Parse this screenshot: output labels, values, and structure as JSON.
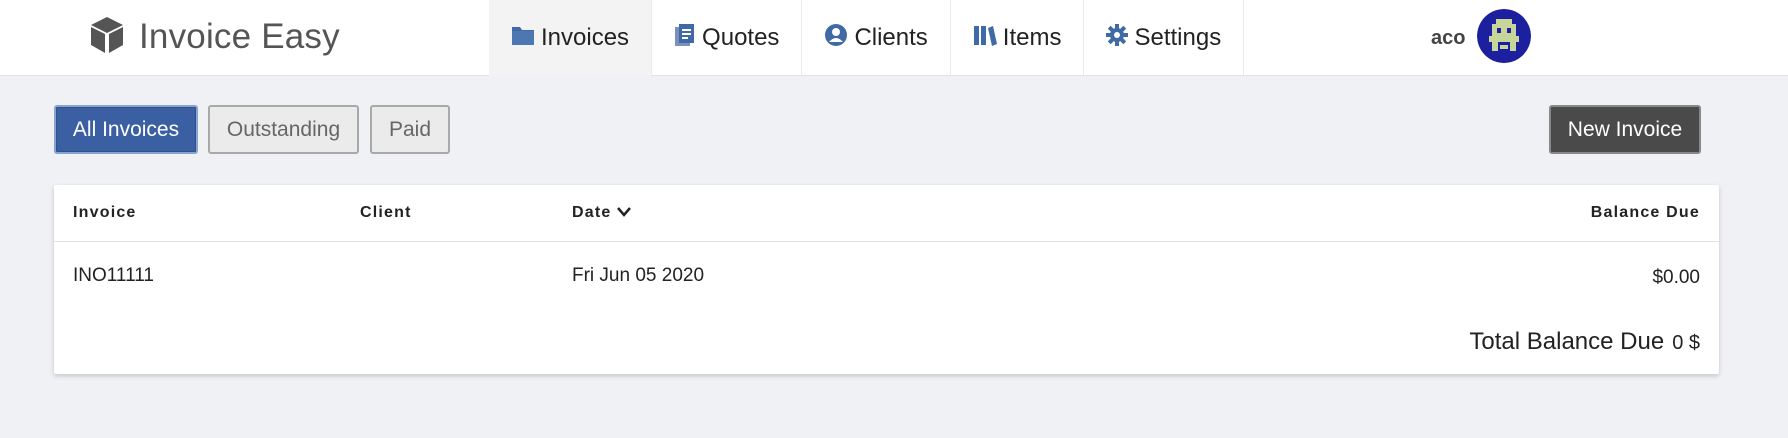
{
  "app": {
    "title": "Invoice Easy"
  },
  "nav": {
    "items": [
      {
        "label": "Invoices",
        "icon": "folder-icon",
        "active": true
      },
      {
        "label": "Quotes",
        "icon": "document-icon",
        "active": false
      },
      {
        "label": "Clients",
        "icon": "user-circle-icon",
        "active": false
      },
      {
        "label": "Items",
        "icon": "books-icon",
        "active": false
      },
      {
        "label": "Settings",
        "icon": "gear-icon",
        "active": false
      }
    ]
  },
  "user": {
    "name": "aco",
    "avatar_icon": "pixel-avatar-icon"
  },
  "filters": {
    "all": "All Invoices",
    "outstanding": "Outstanding",
    "paid": "Paid",
    "selected": "All Invoices"
  },
  "actions": {
    "new_invoice": "New Invoice"
  },
  "table": {
    "headers": {
      "invoice": "Invoice",
      "client": "Client",
      "date": "Date",
      "balance": "Balance Due"
    },
    "sort": {
      "column": "Date",
      "icon": "chevron-down-icon"
    },
    "rows": [
      {
        "invoice": "INO11111",
        "client": "",
        "date": "Fri Jun 05 2020",
        "balance": "$0.00"
      }
    ],
    "total_label": "Total Balance Due",
    "total_value": "0 $"
  },
  "colors": {
    "primary": "#3a5fa3",
    "dark_button": "#4a4a4a",
    "icon_blue": "#3f6aa6",
    "background": "#f0f1f4"
  }
}
